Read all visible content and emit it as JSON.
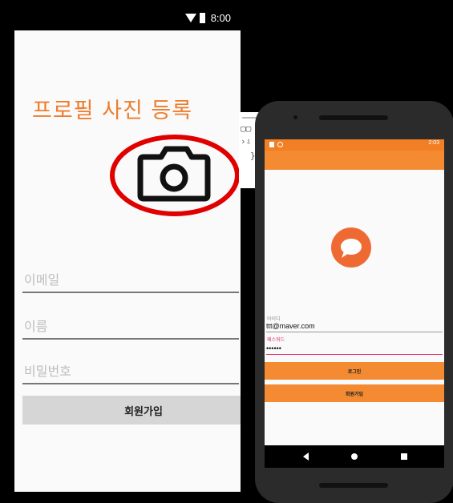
{
  "signup_screen": {
    "status_time": "8:00",
    "title": "프로필 사진 등록",
    "fields": [
      {
        "placeholder": "이메일"
      },
      {
        "placeholder": "이름"
      },
      {
        "placeholder": "비밀번호"
      }
    ],
    "signup_button": "회원가입",
    "icons": {
      "camera": "camera-icon",
      "highlight": "red-circle-annotation"
    }
  },
  "login_screen": {
    "status_time": "2:03",
    "id_label": "아이디",
    "id_value": "ttt@maver.com",
    "password_label": "패스워드",
    "password_value": "••••••",
    "login_button": "로그인",
    "signup_button": "회원가입",
    "icons": {
      "logo": "chat-bubble-icon"
    }
  },
  "colors": {
    "accent_orange": "#f48a32",
    "title_orange": "#ee7d2c",
    "highlight_red": "#e00000",
    "field_active_pink": "#e0306a"
  }
}
